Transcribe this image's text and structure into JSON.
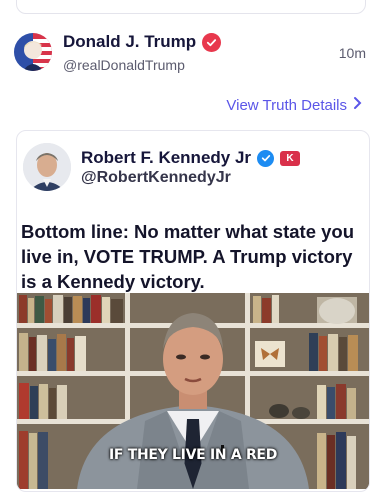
{
  "post": {
    "author_name": "Donald J. Trump",
    "author_handle": "@realDonaldTrump",
    "time": "10m",
    "view_details_label": "View Truth Details",
    "verified_color": "#e8384d"
  },
  "quoted": {
    "author_name": "Robert F. Kennedy Jr",
    "author_handle": "@RobertKennedyJr",
    "verified_color": "#1d8cf2",
    "badge_text": "K",
    "text": "Bottom line: No matter what state you live in, VOTE TRUMP. A Trump victory is a Kennedy victory.",
    "video_caption": "IF THEY LIVE IN A RED"
  },
  "icons": {
    "verified": "checkmark-badge-icon",
    "chevron": "chevron-right-icon"
  },
  "colors": {
    "accent": "#5b56e8",
    "text": "#16163a",
    "muted": "#5b5b6e"
  }
}
